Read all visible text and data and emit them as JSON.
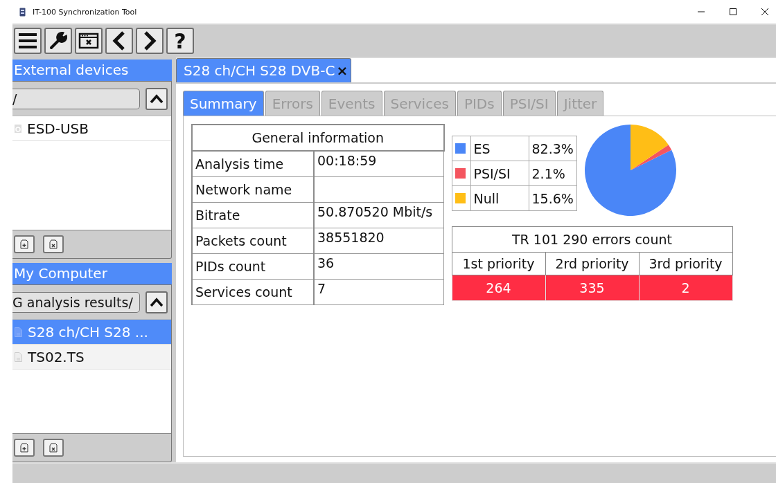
{
  "window": {
    "title": "IT-100 Synchronization Tool"
  },
  "toolbar": [
    {
      "kind": "menu"
    },
    {
      "kind": "wrench"
    },
    {
      "kind": "window-close"
    },
    {
      "kind": "back"
    },
    {
      "kind": "forward"
    },
    {
      "kind": "text",
      "label": "?"
    }
  ],
  "panels": [
    {
      "title": "External devices",
      "path": "/",
      "items": [
        {
          "kind": "drive",
          "label": "ESD-USB",
          "selected": false
        }
      ]
    },
    {
      "title": "My Computer",
      "path": "G analysis results/",
      "items": [
        {
          "kind": "file",
          "label": "S28 ch/CH S28 ...",
          "selected": true
        },
        {
          "kind": "file",
          "label": "TS02.TS",
          "selected": false
        }
      ]
    }
  ],
  "document_tab": {
    "label": "S28 ch/CH S28 DVB-C",
    "close": "×"
  },
  "tabs": [
    {
      "label": "Summary",
      "selected": true
    },
    {
      "label": "Errors",
      "selected": false
    },
    {
      "label": "Events",
      "selected": false
    },
    {
      "label": "Services",
      "selected": false
    },
    {
      "label": "PIDs",
      "selected": false
    },
    {
      "label": "PSI/SI",
      "selected": false
    },
    {
      "label": "Jitter",
      "selected": false
    }
  ],
  "general_information": {
    "title": "General information",
    "rows": [
      {
        "label": "Analysis time",
        "value": "00:18:59"
      },
      {
        "label": "Network name",
        "value": ""
      },
      {
        "label": "Bitrate",
        "value": "50.870520 Mbit/s"
      },
      {
        "label": "Packets count",
        "value": "38551820"
      },
      {
        "label": "PIDs count",
        "value": "36"
      },
      {
        "label": "Services count",
        "value": "7"
      }
    ]
  },
  "packet_share": {
    "legend": [
      {
        "percent": "82.3%",
        "color": "#4a86f7"
      },
      {
        "percent": "2.1%",
        "color": "#f4555f"
      },
      {
        "percent": "15.6%",
        "color": "#ffbe16"
      }
    ],
    "chart_data": {
      "type": "pie",
      "categories": [
        "ES",
        "PSI/SI",
        "Null"
      ],
      "values": [
        82.3,
        2.1,
        15.6
      ]
    }
  },
  "errors_count": {
    "title": "TR 101 290 errors count",
    "columns": [
      "1st priority",
      "2rd priority",
      "3rd priority"
    ],
    "values": [
      "264",
      "335",
      "2"
    ]
  }
}
